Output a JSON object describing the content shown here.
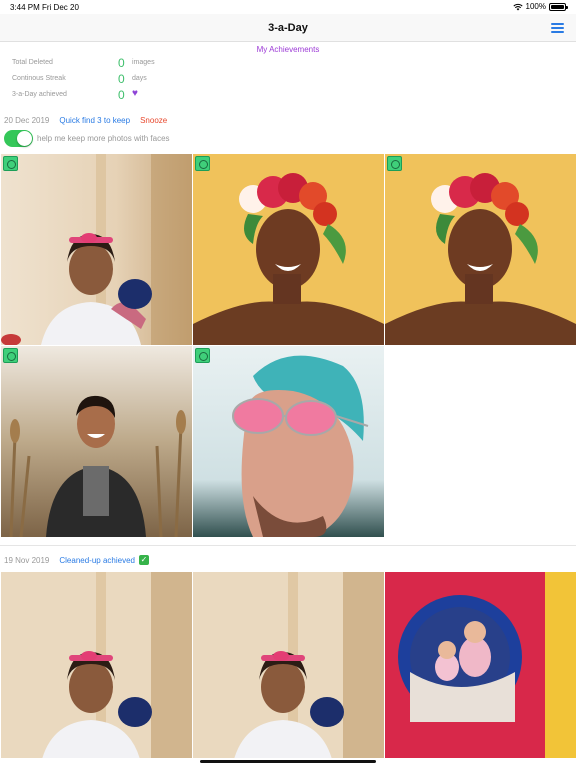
{
  "status_bar": {
    "time": "3:44 PM",
    "date": "Fri Dec 20",
    "battery": "100%"
  },
  "nav": {
    "title": "3-a-Day"
  },
  "achievements_link": "My Achievements",
  "stats": [
    {
      "label": "Total Deleted",
      "value": "0",
      "unit": "images"
    },
    {
      "label": "Continous Streak",
      "value": "0",
      "unit": "days"
    },
    {
      "label": "3-a-Day achieved",
      "value": "0",
      "unit": ""
    }
  ],
  "section1": {
    "date": "20 Dec 2019",
    "quick_find": "Quick find 3 to keep",
    "snooze": "Snooze",
    "faces_toggle_label": "help me keep more photos with faces",
    "faces_toggle_on": true
  },
  "section2": {
    "date": "19 Nov 2019",
    "status": "Cleaned-up achieved",
    "check": "✓"
  },
  "photos": [
    {
      "name": "photo-girl-boxing-glove"
    },
    {
      "name": "photo-woman-flower-crown"
    },
    {
      "name": "photo-woman-flower-crown-duplicate"
    },
    {
      "name": "photo-man-dark-jacket"
    },
    {
      "name": "photo-man-pink-sunglasses"
    },
    {
      "name": "photo-girl-boxing-glove-2"
    },
    {
      "name": "photo-girl-boxing-glove-3"
    },
    {
      "name": "photo-kids-playground-tunnel"
    }
  ],
  "colors": {
    "accent_blue": "#2a7be4",
    "purple": "#9c3ad6",
    "green": "#3fbf6c",
    "red": "#e8482d"
  }
}
